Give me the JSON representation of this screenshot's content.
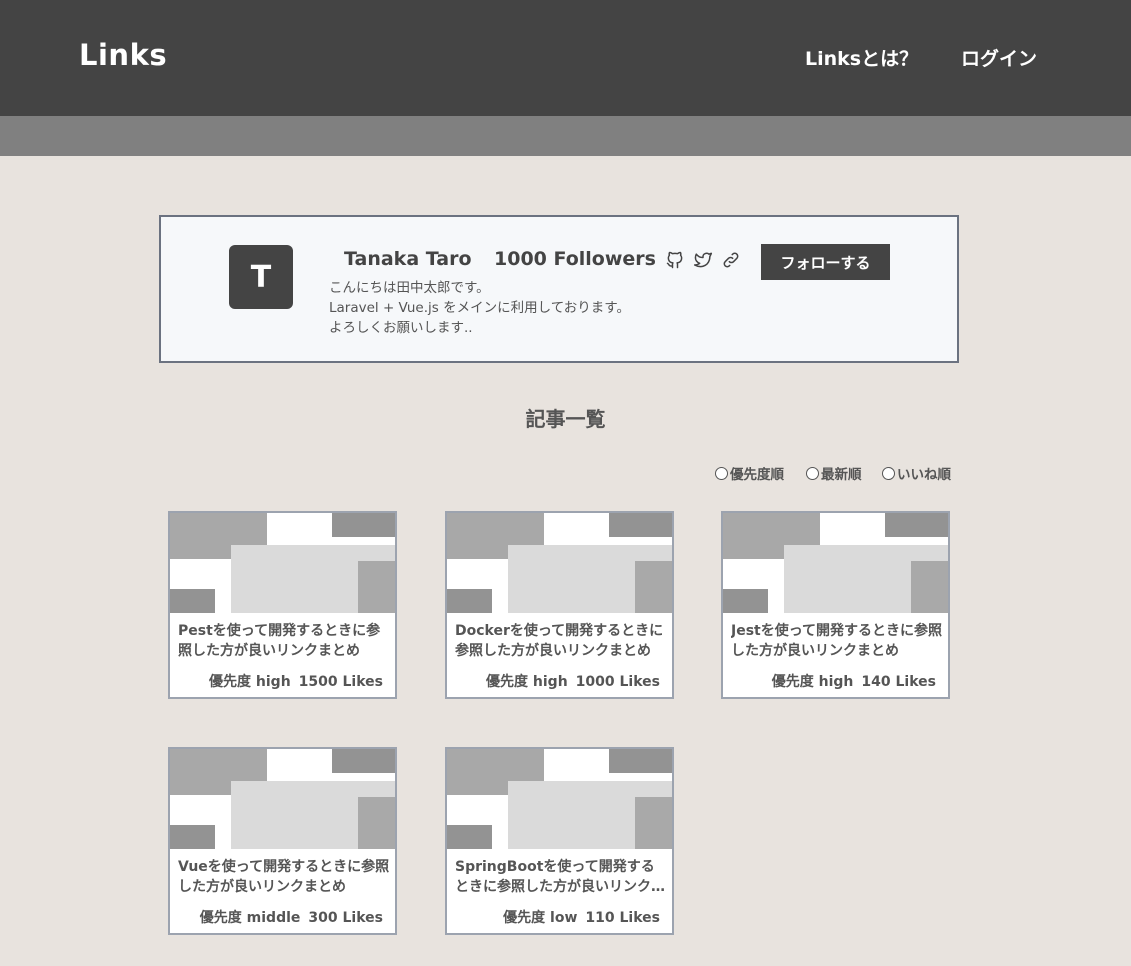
{
  "header": {
    "logo": "Links",
    "nav": {
      "about": "Linksとは？",
      "login": "ログイン"
    }
  },
  "profile": {
    "avatar_initial": "T",
    "name": "Tanaka Taro",
    "followers": "1000 Followers",
    "icons": [
      "github-icon",
      "twitter-icon",
      "link-icon"
    ],
    "follow_label": "フォローする",
    "bio": [
      "こんにちは田中太郎です。",
      "Laravel + Vue.js をメインに利用しております。",
      "よろしくお願いします.."
    ]
  },
  "articles": {
    "title": "記事一覧",
    "sort_options": [
      "優先度順",
      "最新順",
      "いいね順"
    ],
    "items": [
      {
        "title": "Pestを使って開発するときに参照した方が良いリンクまとめ",
        "priority": "優先度 high",
        "likes": "1500 Likes"
      },
      {
        "title": "Dockerを使って開発するときに参照した方が良いリンクまとめ",
        "priority": "優先度 high",
        "likes": "1000 Likes"
      },
      {
        "title": "Jestを使って開発するときに参照した方が良いリンクまとめ",
        "priority": "優先度 high",
        "likes": "140 Likes"
      },
      {
        "title": "Vueを使って開発するときに参照した方が良いリンクまとめ",
        "priority": "優先度 middle",
        "likes": "300 Likes"
      },
      {
        "title": "SpringBootを使って開発するときに参照した方が良いリンクまとめ",
        "priority": "優先度 low",
        "likes": "110 Likes"
      }
    ]
  },
  "colors": {
    "header_bg": "#444444",
    "subbar_bg": "#808080",
    "page_bg": "#e8e3de",
    "profile_bg": "#f6f8fa",
    "button_bg": "#444444"
  }
}
